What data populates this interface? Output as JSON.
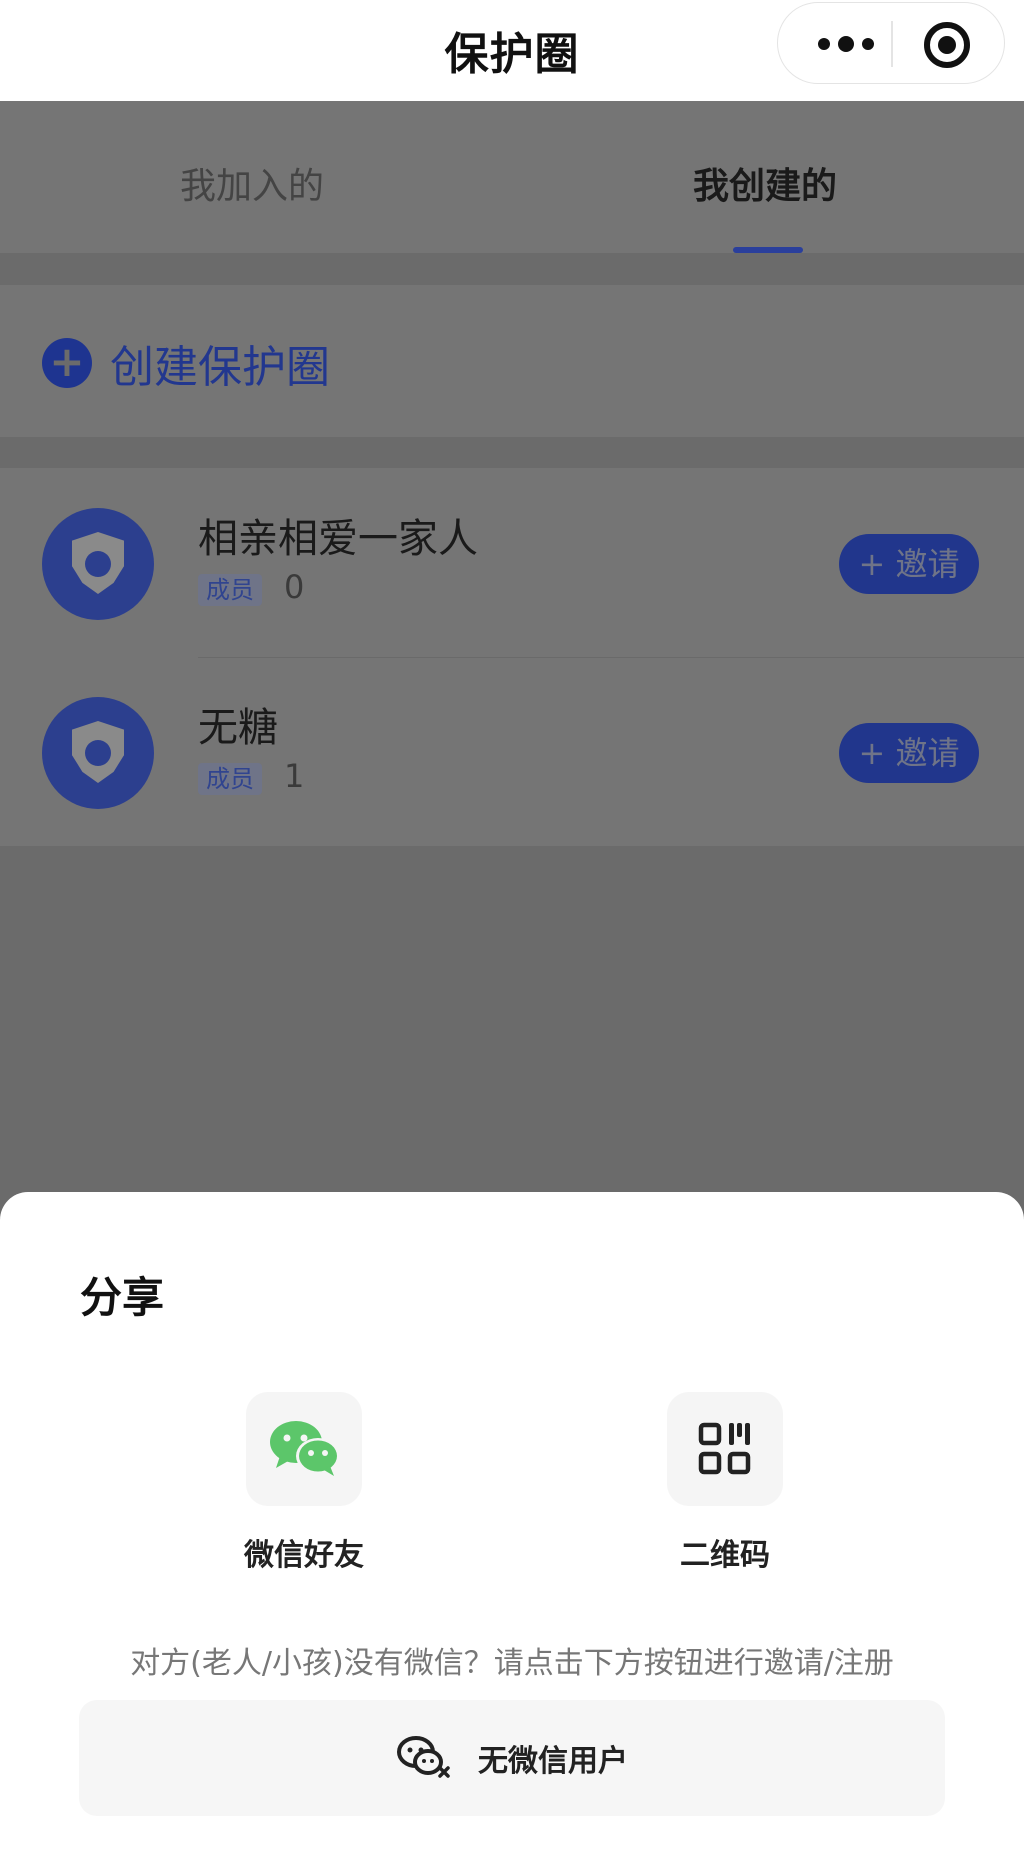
{
  "header": {
    "title": "保护圈"
  },
  "tabs": [
    {
      "label": "我加入的",
      "active": false
    },
    {
      "label": "我创建的",
      "active": true
    }
  ],
  "create": {
    "plus": "+",
    "label": "创建保护圈"
  },
  "circles": [
    {
      "name": "相亲相爱一家人",
      "member_label": "成员",
      "member_count": "0",
      "invite_label": "+ 邀请"
    },
    {
      "name": "无糖",
      "member_label": "成员",
      "member_count": "1",
      "invite_label": "+ 邀请"
    }
  ],
  "share_sheet": {
    "title": "分享",
    "options": [
      {
        "label": "微信好友",
        "icon": "wechat-icon"
      },
      {
        "label": "二维码",
        "icon": "qrcode-icon"
      }
    ],
    "hint": "对方(老人/小孩)没有微信？请点击下方按钮进行邀请/注册",
    "no_wechat_button": {
      "label": "无微信用户",
      "icon": "wechat-off-icon"
    }
  },
  "colors": {
    "accent": "#2a3f9c",
    "wechat_green": "#5cc66a",
    "overlay": "#6b6b6b"
  }
}
